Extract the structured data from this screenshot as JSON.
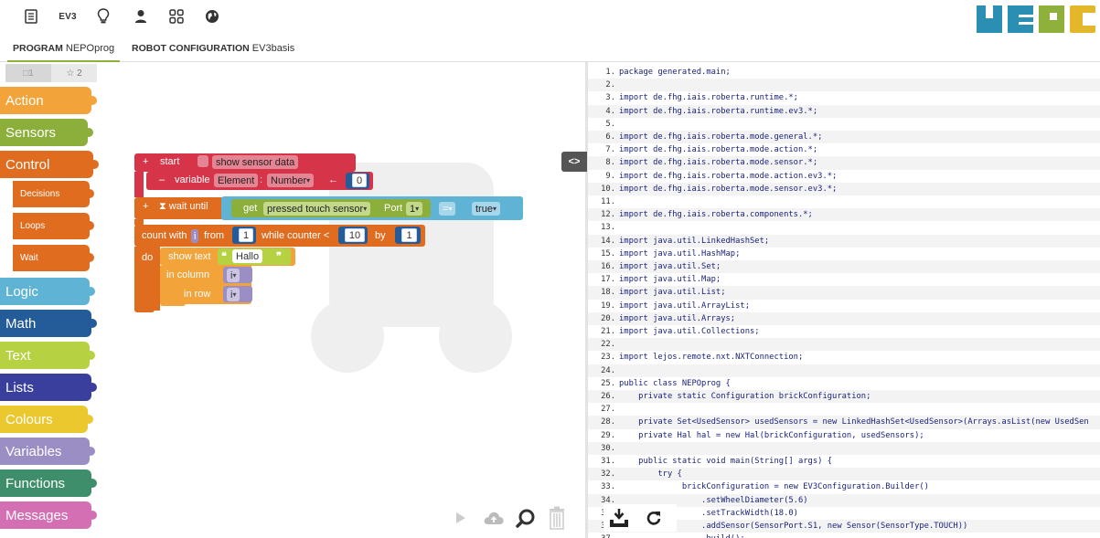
{
  "topbar": {
    "ev3_label": "EV3",
    "icons": [
      "program-list-icon",
      "ev3-robot-icon",
      "lightbulb-icon",
      "user-icon",
      "gallery-grid-icon",
      "language-globe-icon"
    ],
    "logo_colors": [
      "#2a8fb3",
      "#2a8fb3",
      "#8fb03a",
      "#e4b629"
    ]
  },
  "tabs": {
    "program_label": "PROGRAM",
    "program_name": "NEPOprog",
    "robot_label": "ROBOT CONFIGURATION",
    "robot_name": "EV3basis"
  },
  "toolbox": {
    "tab1": "□1",
    "tab2": "☆ 2",
    "categories": [
      {
        "label": "Action",
        "color": "#f2a33a"
      },
      {
        "label": "Sensors",
        "color": "#8cae3a"
      },
      {
        "label": "Control",
        "color": "#e06d1f"
      },
      {
        "label": "Logic",
        "color": "#5fb4d5"
      },
      {
        "label": "Math",
        "color": "#245b99"
      },
      {
        "label": "Text",
        "color": "#b6d142"
      },
      {
        "label": "Lists",
        "color": "#3a3f9e"
      },
      {
        "label": "Colours",
        "color": "#ebc82d"
      },
      {
        "label": "Variables",
        "color": "#9b8ec4"
      },
      {
        "label": "Functions",
        "color": "#3f8e6b"
      },
      {
        "label": "Messages",
        "color": "#d56fb4"
      }
    ],
    "subcategories": [
      {
        "label": "Decisions"
      },
      {
        "label": "Loops"
      },
      {
        "label": "Wait"
      }
    ]
  },
  "blocks": {
    "start_plus": "+",
    "start_label": "start",
    "show_sensor_data": "show sensor data",
    "variable_minus": "–",
    "variable_label": "variable",
    "variable_name": "Element",
    "variable_type": "Number",
    "variable_arrow": "←",
    "variable_value": "0",
    "wait_plus": "+",
    "wait_label": "⧗ wait until",
    "get_label": "get",
    "sensor_type": "pressed",
    "sensor_name": "touch sensor",
    "port_label": "Port",
    "port_value": "1",
    "eq_label": "=",
    "true_label": "true",
    "count_with": "count with",
    "counter_var": "i",
    "from_label": "from",
    "from_value": "1",
    "while_label": "while counter <",
    "while_value": "10",
    "by_label": "by",
    "by_value": "1",
    "do_label": "do",
    "show_text": "show text",
    "text_value": "Hallo",
    "in_column": "in column",
    "column_var": "i",
    "in_row": "in row",
    "row_var": "i"
  },
  "split_toggle": "<>",
  "code": [
    {
      "n": "1.",
      "t": "package generated.main;"
    },
    {
      "n": "2.",
      "t": ""
    },
    {
      "n": "3.",
      "t": "import de.fhg.iais.roberta.runtime.*;"
    },
    {
      "n": "4.",
      "t": "import de.fhg.iais.roberta.runtime.ev3.*;"
    },
    {
      "n": "5.",
      "t": ""
    },
    {
      "n": "6.",
      "t": "import de.fhg.iais.roberta.mode.general.*;"
    },
    {
      "n": "7.",
      "t": "import de.fhg.iais.roberta.mode.action.*;"
    },
    {
      "n": "8.",
      "t": "import de.fhg.iais.roberta.mode.sensor.*;"
    },
    {
      "n": "9.",
      "t": "import de.fhg.iais.roberta.mode.action.ev3.*;"
    },
    {
      "n": "10.",
      "t": "import de.fhg.iais.roberta.mode.sensor.ev3.*;"
    },
    {
      "n": "11.",
      "t": ""
    },
    {
      "n": "12.",
      "t": "import de.fhg.iais.roberta.components.*;"
    },
    {
      "n": "13.",
      "t": ""
    },
    {
      "n": "14.",
      "t": "import java.util.LinkedHashSet;"
    },
    {
      "n": "15.",
      "t": "import java.util.HashMap;"
    },
    {
      "n": "16.",
      "t": "import java.util.Set;"
    },
    {
      "n": "17.",
      "t": "import java.util.Map;"
    },
    {
      "n": "18.",
      "t": "import java.util.List;"
    },
    {
      "n": "19.",
      "t": "import java.util.ArrayList;"
    },
    {
      "n": "20.",
      "t": "import java.util.Arrays;"
    },
    {
      "n": "21.",
      "t": "import java.util.Collections;"
    },
    {
      "n": "22.",
      "t": ""
    },
    {
      "n": "23.",
      "t": "import lejos.remote.nxt.NXTConnection;"
    },
    {
      "n": "24.",
      "t": ""
    },
    {
      "n": "25.",
      "t": "public class NEPOprog {"
    },
    {
      "n": "26.",
      "t": "    private static Configuration brickConfiguration;"
    },
    {
      "n": "27.",
      "t": ""
    },
    {
      "n": "28.",
      "t": "    private Set<UsedSensor> usedSensors = new LinkedHashSet<UsedSensor>(Arrays.asList(new UsedSen"
    },
    {
      "n": "29.",
      "t": "    private Hal hal = new Hal(brickConfiguration, usedSensors);"
    },
    {
      "n": "30.",
      "t": ""
    },
    {
      "n": "31.",
      "t": "    public static void main(String[] args) {"
    },
    {
      "n": "32.",
      "t": "        try {"
    },
    {
      "n": "33.",
      "t": "             brickConfiguration = new EV3Configuration.Builder()"
    },
    {
      "n": "34.",
      "t": "                 .setWheelDiameter(5.6)"
    },
    {
      "n": "35.",
      "t": "                 .setTrackWidth(18.0)"
    },
    {
      "n": "36.",
      "t": "                 .addSensor(SensorPort.S1, new Sensor(SensorType.TOUCH))"
    },
    {
      "n": "37.",
      "t": "                 .build();"
    }
  ]
}
